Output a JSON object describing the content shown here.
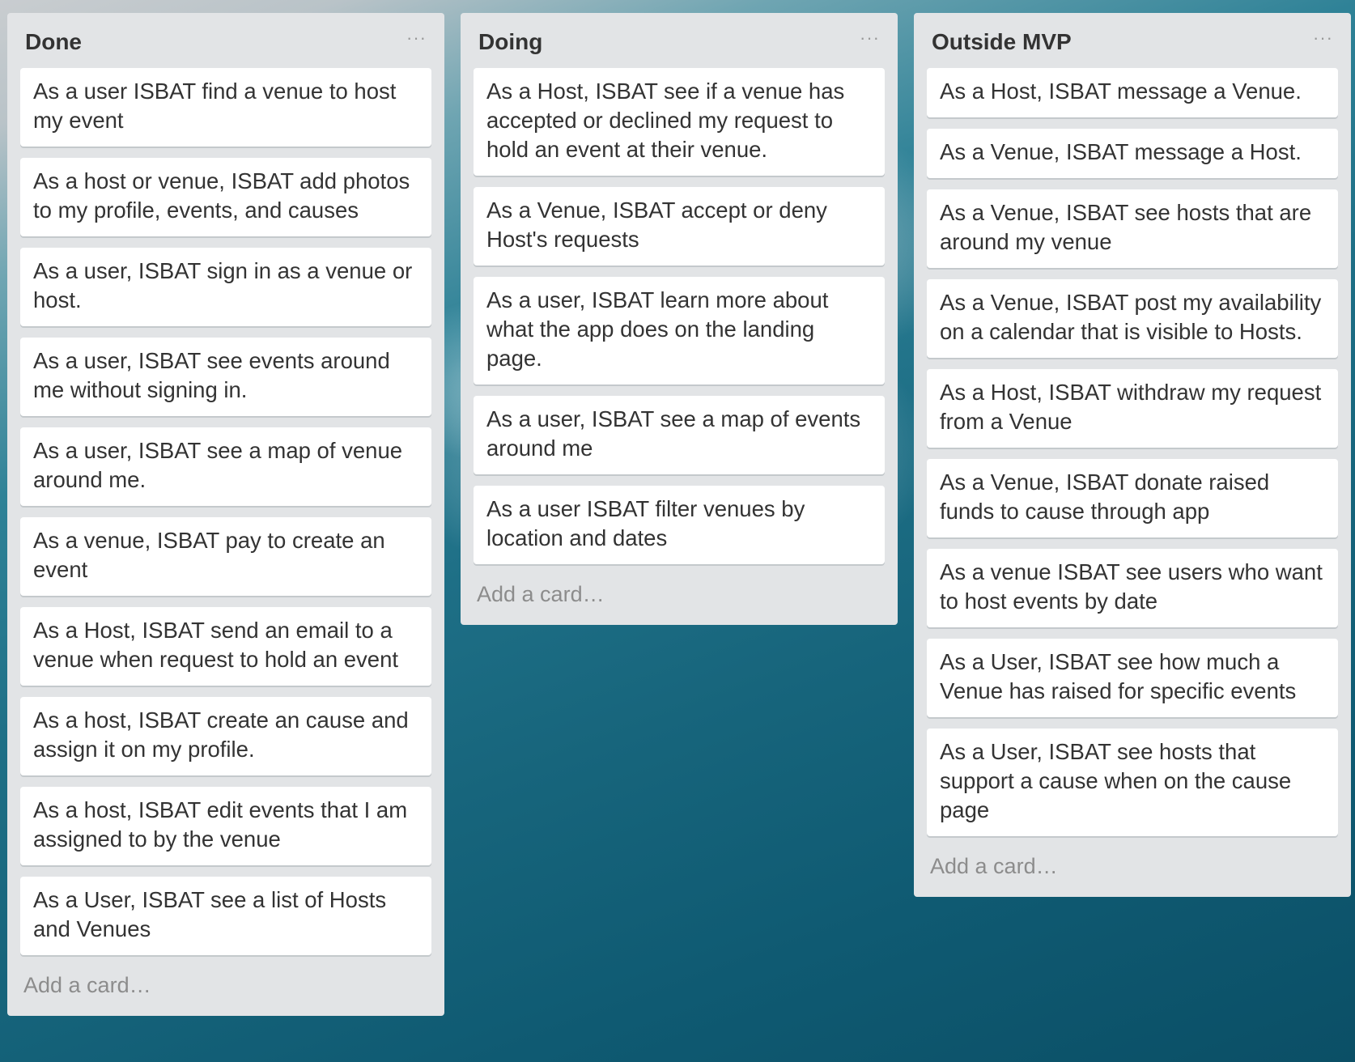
{
  "lists": [
    {
      "title": "Done",
      "menu": "···",
      "add_card": "Add a card…",
      "cards": [
        "As a user ISBAT find a venue to host my event",
        "As a host or venue, ISBAT add photos to my profile, events, and causes",
        "As a user, ISBAT sign in as a venue or host.",
        "As a user, ISBAT see events around me without signing in.",
        "As a user, ISBAT see a map of venue around me.",
        "As a venue, ISBAT pay to create an event",
        "As a Host, ISBAT send an email to a venue when request to hold an event",
        "As a host, ISBAT create an cause and assign it on my profile.",
        "As a host, ISBAT edit events that I am assigned to by the venue",
        "As a User, ISBAT see a list of Hosts and Venues"
      ]
    },
    {
      "title": "Doing",
      "menu": "···",
      "add_card": "Add a card…",
      "cards": [
        "As a Host, ISBAT see if a venue has accepted or declined my request to hold an event at their venue.",
        "As a Venue, ISBAT accept or deny Host's requests",
        "As a user, ISBAT learn more about what the app does on the landing page.",
        "As a user, ISBAT see a map of events around me",
        "As a user ISBAT filter venues by location and dates"
      ]
    },
    {
      "title": "Outside MVP",
      "menu": "···",
      "add_card": "Add a card…",
      "cards": [
        "As a Host, ISBAT message a Venue.",
        "As a Venue, ISBAT message a Host.",
        "As a Venue, ISBAT see hosts that are around my venue",
        "As a Venue, ISBAT post my availability on a calendar that is visible to Hosts.",
        "As a Host, ISBAT withdraw my request from a Venue",
        "As a Venue, ISBAT donate raised funds to cause through app",
        "As a venue ISBAT see users who want to host events by date",
        "As a User, ISBAT see how much a Venue has raised for specific events",
        "As a User, ISBAT see hosts that support a cause when on the cause page"
      ]
    }
  ]
}
